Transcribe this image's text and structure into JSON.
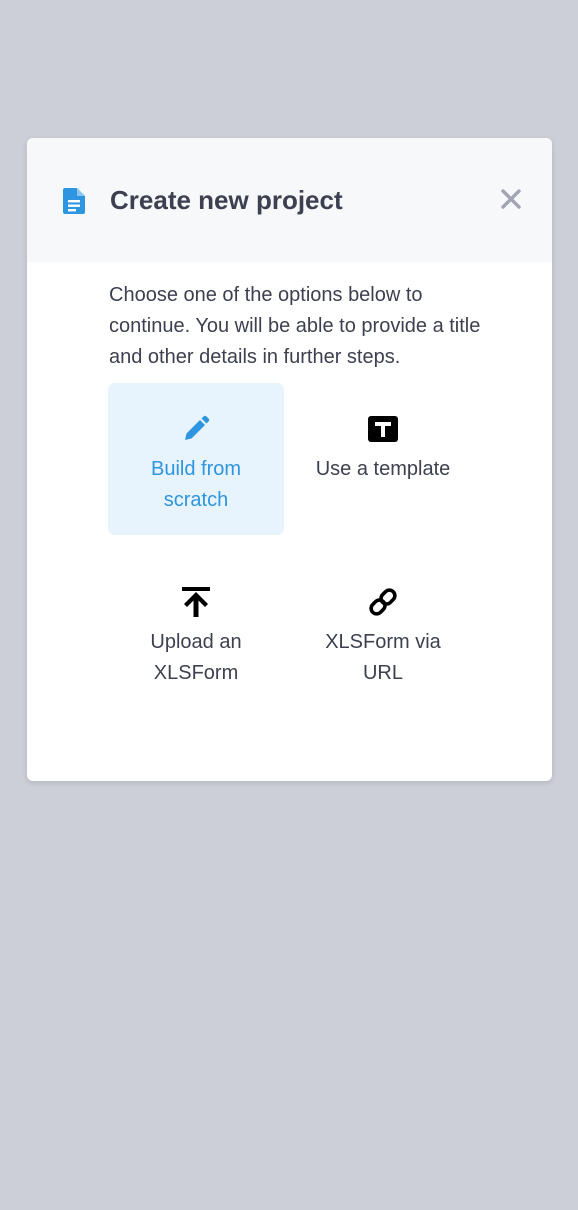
{
  "modal": {
    "title": "Create new project",
    "close_label": "×",
    "intro": "Choose one of the options below to continue. You will be able to provide a title and other details in further steps."
  },
  "options": [
    {
      "label": "Build from scratch",
      "icon": "pencil-icon",
      "selected": true
    },
    {
      "label": "Use a template",
      "icon": "template-icon",
      "selected": false
    },
    {
      "label": "Upload an XLSForm",
      "icon": "upload-icon",
      "selected": false
    },
    {
      "label": "XLSForm via URL",
      "icon": "link-icon",
      "selected": false
    }
  ],
  "colors": {
    "accent": "#2e95e1",
    "selected_bg": "#e7f3fd",
    "text": "#3d4050",
    "header_bg": "#f7f8fa",
    "backdrop": "#cdcfd8"
  }
}
